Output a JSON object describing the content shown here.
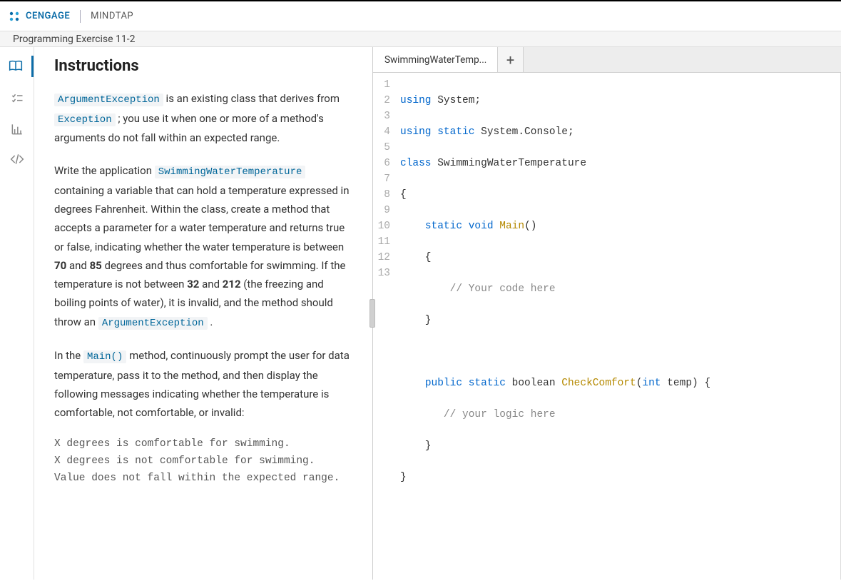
{
  "header": {
    "brand": "CENGAGE",
    "product": "MINDTAP"
  },
  "subheader": {
    "title": "Programming Exercise 11-2"
  },
  "sidebar": {
    "items": [
      {
        "name": "book-icon",
        "active": true
      },
      {
        "name": "checklist-icon",
        "active": false
      },
      {
        "name": "chart-icon",
        "active": false
      },
      {
        "name": "code-icon",
        "active": false
      }
    ]
  },
  "instructions": {
    "title": "Instructions",
    "p1_a": "ArgumentException",
    "p1_b": " is an existing class that derives from ",
    "p1_c": "Exception",
    "p1_d": " ; you use it when one or more of a method's arguments do not fall within an expected range.",
    "p2_a": "Write the application ",
    "p2_b": "SwimmingWaterTemperature",
    "p2_c": " containing a variable that can hold a temperature expressed in degrees Fahrenheit. Within the class, create a method that accepts a parameter for a water temperature and returns true or false, indicating whether the water temperature is between ",
    "p2_d": "70",
    "p2_e": " and ",
    "p2_f": "85",
    "p2_g": " degrees and thus comfortable for swimming. If the temperature is not between ",
    "p2_h": "32",
    "p2_i": " and ",
    "p2_j": "212",
    "p2_k": " (the freezing and boiling points of water), it is invalid, and the method should throw an ",
    "p2_l": "ArgumentException",
    "p2_m": " .",
    "p3_a": "In the ",
    "p3_b": "Main()",
    "p3_c": " method, continuously prompt the user for data temperature, pass it to the method, and then display the following messages indicating whether the temperature is comfortable, not comfortable, or invalid:",
    "codeblock": "X degrees is comfortable for swimming.\nX degrees is not comfortable for swimming.\nValue does not fall within the expected range."
  },
  "editor": {
    "tab_label": "SwimmingWaterTemp...",
    "add_tab": "+",
    "line_count": 13,
    "code": {
      "l1": {
        "a": "using",
        "b": " System;"
      },
      "l2": {
        "a": "using",
        "b": " static",
        "c": " System.Console;"
      },
      "l3": {
        "a": "class",
        "b": " SwimmingWaterTemperature"
      },
      "l4": {
        "a": "{"
      },
      "l5": {
        "a": "    ",
        "b": "static",
        "c": " void",
        "d": " Main",
        "e": "()"
      },
      "l6": {
        "a": "    {"
      },
      "l7": {
        "a": "        ",
        "b": "// Your code here"
      },
      "l8": {
        "a": "    }"
      },
      "l9": {
        "a": ""
      },
      "l10": {
        "a": "    ",
        "b": "public",
        "c": " static",
        "d": " boolean ",
        "e": "CheckComfort",
        "f": "(",
        "g": "int",
        "h": " temp) {"
      },
      "l11": {
        "a": "       ",
        "b": "// your logic here"
      },
      "l12": {
        "a": "    }"
      },
      "l13": {
        "a": "}"
      }
    }
  }
}
